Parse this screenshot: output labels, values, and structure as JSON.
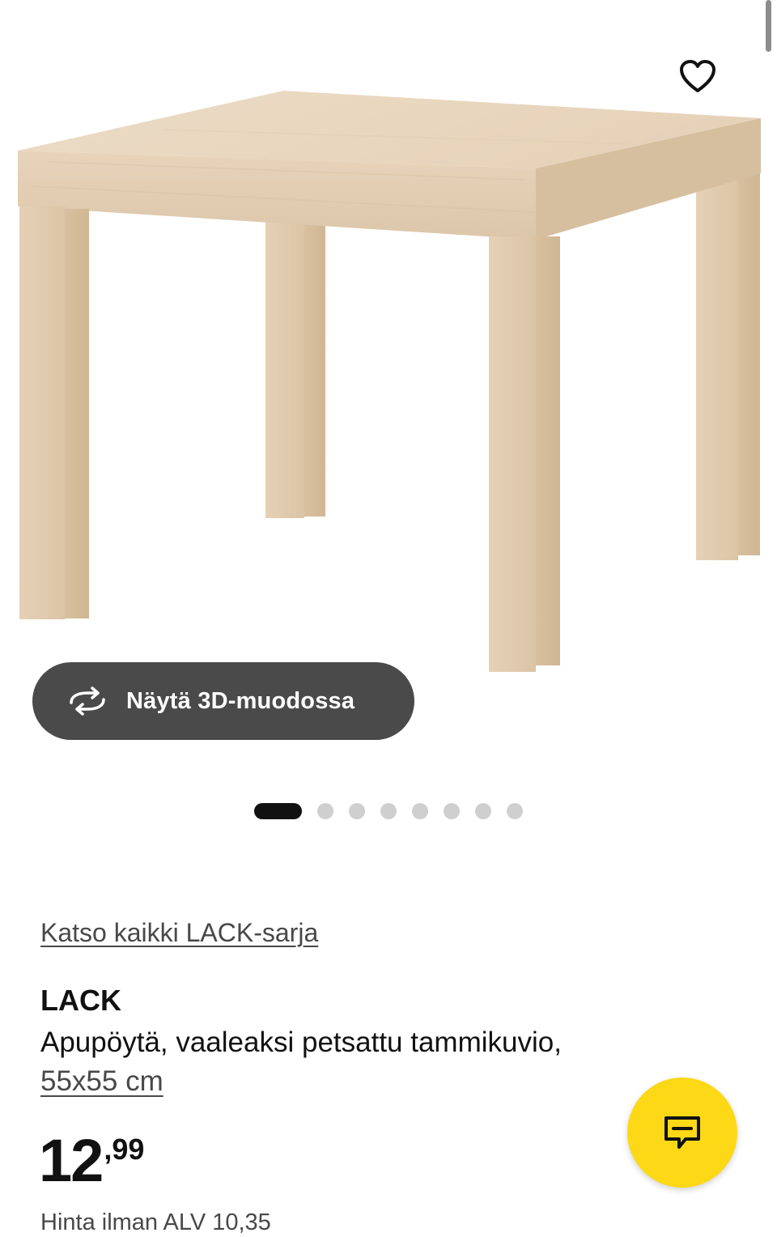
{
  "gallery": {
    "image_alt": "LACK apupöytä",
    "view3d_label": "Näytä 3D-muodossa",
    "dots_total": 8,
    "dots_active_index": 0
  },
  "product": {
    "series_link": "Katso kaikki LACK-sarja",
    "name": "LACK",
    "description": "Apupöytä, vaaleaksi petsattu tammikuvio,",
    "size": "55x55 cm",
    "price_int": "12",
    "price_dec": ",99",
    "vat_note": "Hinta ilman ALV 10,35"
  },
  "icons": {
    "favorite": "heart-outline-icon",
    "view3d": "rotate-3d-icon",
    "chat": "chat-bubble-icon"
  },
  "colors": {
    "chat_button": "#fcd816",
    "view3d_button": "#4a4a4a",
    "active_dot": "#111111",
    "inactive_dot": "#cfcfcf"
  }
}
